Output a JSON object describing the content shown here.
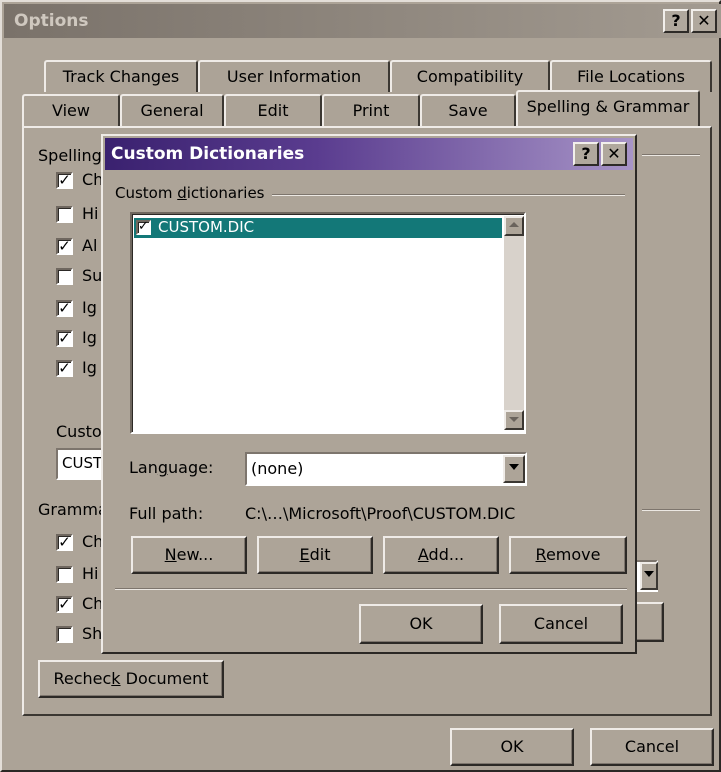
{
  "options": {
    "title": "Options",
    "help_glyph": "?",
    "close_glyph": "✕",
    "tabs_row1": [
      "Track Changes",
      "User Information",
      "Compatibility",
      "File Locations"
    ],
    "tabs_row2": [
      "View",
      "General",
      "Edit",
      "Print",
      "Save",
      "Spelling & Grammar"
    ],
    "active_tab": "Spelling & Grammar",
    "section_spelling": "Spelling",
    "spelling_items": [
      {
        "label": "Ch",
        "checked": true
      },
      {
        "label": "Hi",
        "checked": false
      },
      {
        "label": "Al",
        "checked": true
      },
      {
        "label": "Su",
        "checked": false
      },
      {
        "label": "Ig",
        "checked": true
      },
      {
        "label": "Ig",
        "checked": true
      },
      {
        "label": "Ig",
        "checked": true
      }
    ],
    "custom_label": "Custo",
    "custom_value": "CUST",
    "section_grammar": "Gramma",
    "grammar_items": [
      {
        "label": "Ch",
        "checked": true
      },
      {
        "label": "Hi",
        "checked": false
      },
      {
        "label": "Ch",
        "checked": true
      },
      {
        "label": "Sh",
        "checked": false
      }
    ],
    "recheck_label_pre": "Rechec",
    "recheck_label_acc": "k",
    "recheck_label_post": " Document",
    "ok_label": "OK",
    "cancel_label": "Cancel"
  },
  "dialog": {
    "title": "Custom Dictionaries",
    "help_glyph": "?",
    "close_glyph": "✕",
    "group_label_pre": "Custom ",
    "group_label_acc": "d",
    "group_label_post": "ictionaries",
    "dictionaries": [
      {
        "name": "CUSTOM.DIC",
        "checked": true,
        "selected": true
      }
    ],
    "language_label_pre": "Lan",
    "language_label_acc": "g",
    "language_label_post": "uage:",
    "language_value": "(none)",
    "full_path_label": "Full path:",
    "full_path_value": "C:\\…\\Microsoft\\Proof\\CUSTOM.DIC",
    "buttons": {
      "new_acc": "N",
      "new_rest": "ew...",
      "edit_acc": "E",
      "edit_rest": "dit",
      "add_acc": "A",
      "add_rest": "dd...",
      "remove_acc": "R",
      "remove_rest": "emove"
    },
    "ok_label": "OK",
    "cancel_label": "Cancel"
  },
  "colors": {
    "face": "#ada498",
    "selection": "#137878",
    "dialog_title_start": "#3a216f",
    "dialog_title_end": "#a794c7"
  }
}
